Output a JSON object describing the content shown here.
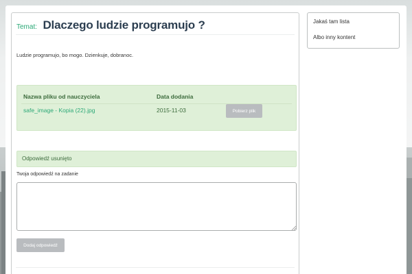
{
  "topic": {
    "label": "Temat:",
    "title": "Dlaczego ludzie programujo ?"
  },
  "description": "Ludzie programujo, bo mogo. Dzienkuje, dobranoc.",
  "files_table": {
    "headers": [
      "Nazwa pliku od nauczyciela",
      "Data dodania"
    ],
    "rows": [
      {
        "file_name": "safe_image - Kopia (22).jpg",
        "date": "2015-11-03",
        "action_label": "Pobierz plik"
      }
    ]
  },
  "alert": {
    "text": "Odpowiedź usunięto"
  },
  "answer_form": {
    "label": "Twoja odpowiedź na zadanie",
    "value": "",
    "submit_label": "Dodaj odpowiedź"
  },
  "sidebar": {
    "items": [
      {
        "label": "Jakaś tam lista"
      },
      {
        "label": "Albo inny kontent"
      }
    ]
  },
  "colors": {
    "accent": "#2aa876",
    "success_bg": "#dff0d8",
    "button_disabled": "#b9bcbf"
  }
}
